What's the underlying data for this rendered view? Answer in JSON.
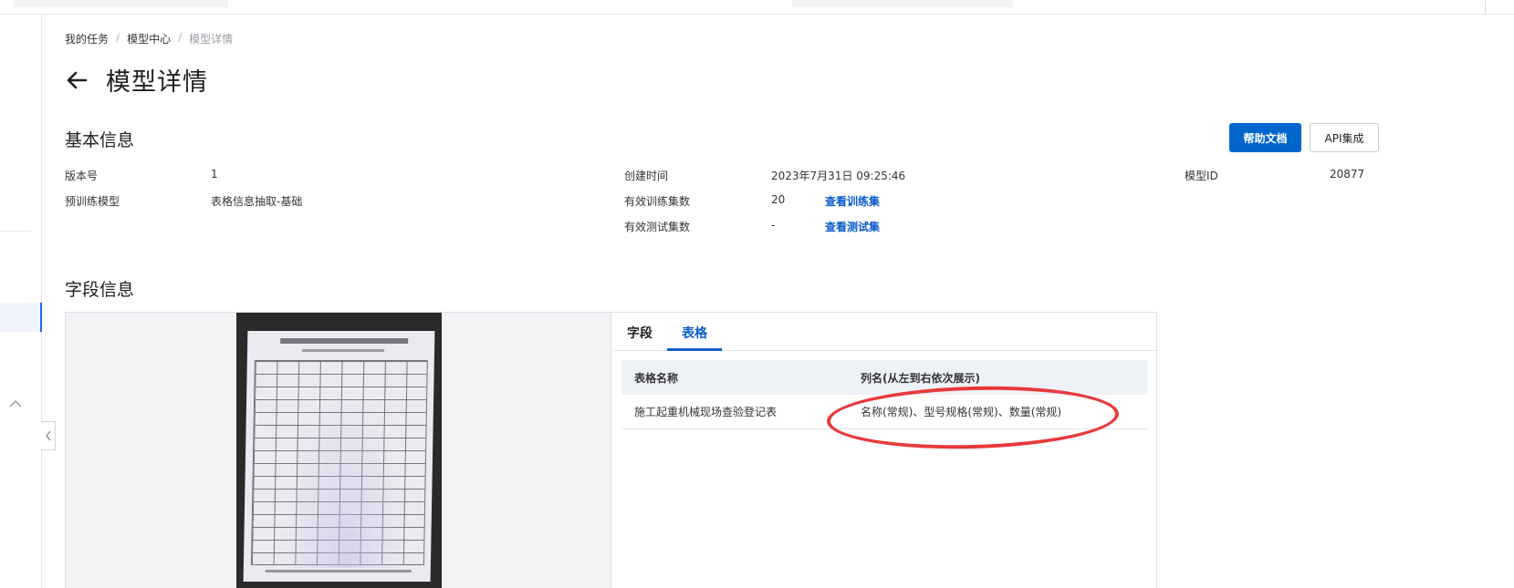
{
  "breadcrumb": {
    "item1": "我的任务",
    "item2": "模型中心",
    "current": "模型详情",
    "sep": "/"
  },
  "page": {
    "title": "模型详情"
  },
  "basic": {
    "title": "基本信息",
    "help_button": "帮助文档",
    "api_button": "API集成",
    "version_label": "版本号",
    "version_value": "1",
    "pretrain_label": "预训练模型",
    "pretrain_value": "表格信息抽取-基础",
    "created_label": "创建时间",
    "created_value": "2023年7月31日 09:25:46",
    "train_label": "有效训练集数",
    "train_value": "20",
    "train_link": "查看训练集",
    "test_label": "有效测试集数",
    "test_value": "-",
    "test_link": "查看测试集",
    "model_id_label": "模型ID",
    "model_id_value": "20877"
  },
  "fields": {
    "title": "字段信息",
    "tabs": [
      "字段",
      "表格"
    ],
    "active_tab": "表格",
    "table": {
      "headers": [
        "表格名称",
        "列名(从左到右依次展示)"
      ],
      "rows": [
        [
          "施工起重机械现场查验登记表",
          "名称(常规)、型号规格(常规)、数量(常规)"
        ]
      ]
    }
  },
  "colors": {
    "primary": "#0066cc",
    "link": "#0b5cc9",
    "highlight": "#e8393b"
  }
}
